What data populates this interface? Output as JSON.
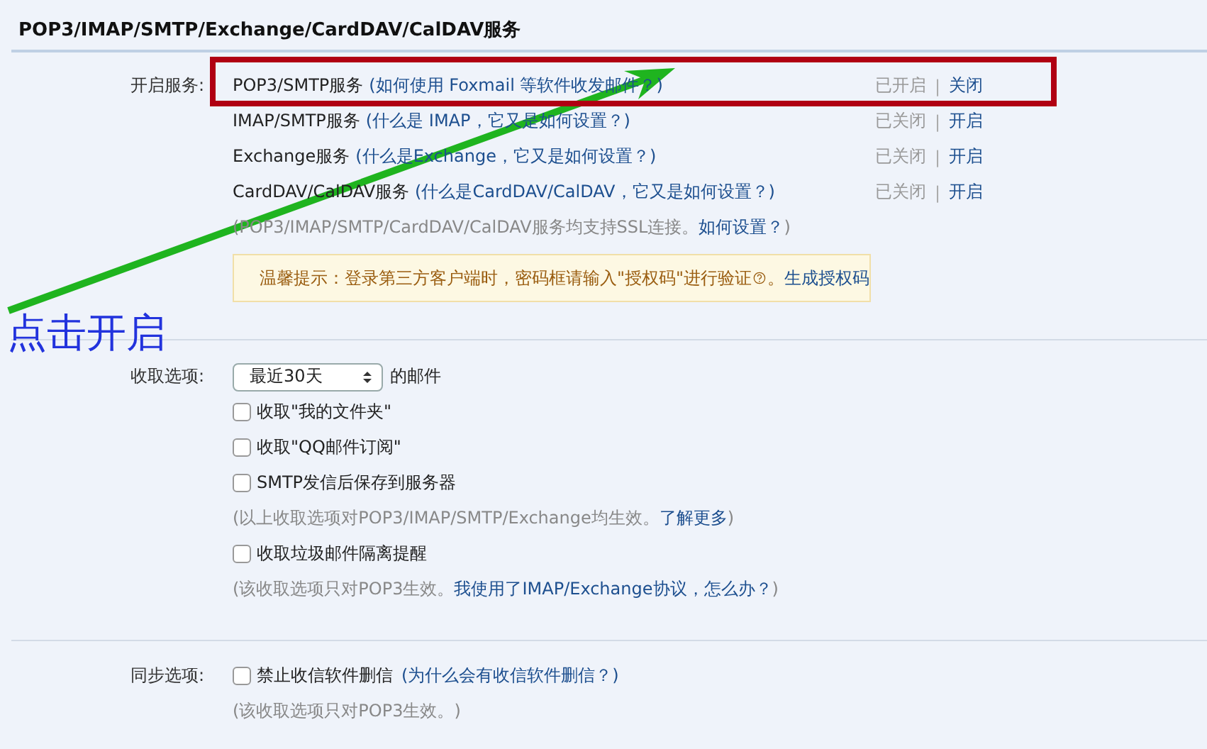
{
  "title": "POP3/IMAP/SMTP/Exchange/CardDAV/CalDAV服务",
  "services": {
    "label": "开启服务:",
    "rows": [
      {
        "name": "POP3/SMTP服务",
        "link": "(如何使用 Foxmail 等软件收发邮件？)",
        "status": "已开启",
        "separator": "|",
        "action": "关闭",
        "highlighted": true
      },
      {
        "name": "IMAP/SMTP服务",
        "link": "(什么是 IMAP，它又是如何设置？)",
        "status": "已关闭",
        "separator": "|",
        "action": "开启",
        "highlighted": false
      },
      {
        "name": "Exchange服务",
        "link": "(什么是Exchange，它又是如何设置？)",
        "status": "已关闭",
        "separator": "|",
        "action": "开启",
        "highlighted": false
      },
      {
        "name": "CardDAV/CalDAV服务",
        "link": "(什么是CardDAV/CalDAV，它又是如何设置？)",
        "status": "已关闭",
        "separator": "|",
        "action": "开启",
        "highlighted": false
      }
    ],
    "note": {
      "text": "(POP3/IMAP/SMTP/CardDAV/CalDAV服务均支持SSL连接。",
      "link": "如何设置？",
      "tail": ")"
    },
    "tip": {
      "text": "温馨提示：登录第三方客户端时，密码框请输入\"授权码\"进行验证",
      "after": "。",
      "link": "生成授权码"
    }
  },
  "receive": {
    "label": "收取选项:",
    "select": "最近30天",
    "select_suffix": "的邮件",
    "items": [
      {
        "kind": "checkbox",
        "label": "收取\"我的文件夹\"",
        "checked": false
      },
      {
        "kind": "checkbox",
        "label": "收取\"QQ邮件订阅\"",
        "checked": false
      },
      {
        "kind": "checkbox",
        "label": "SMTP发信后保存到服务器",
        "checked": false
      },
      {
        "kind": "note",
        "text": "(以上收取选项对POP3/IMAP/SMTP/Exchange均生效。",
        "link": "了解更多",
        "tail": ")"
      },
      {
        "kind": "checkbox",
        "label": "收取垃圾邮件隔离提醒",
        "checked": false
      },
      {
        "kind": "note",
        "text": "(该收取选项只对POP3生效。",
        "link": "我使用了IMAP/Exchange协议，怎么办？",
        "tail": ")"
      }
    ]
  },
  "sync": {
    "label": "同步选项:",
    "items": [
      {
        "kind": "checkbox",
        "label": "禁止收信软件删信",
        "checked": false,
        "link": "(为什么会有收信软件删信？)"
      },
      {
        "kind": "note",
        "text": "(该收取选项只对POP3生效。)"
      }
    ]
  },
  "annotation": {
    "text": "点击开启"
  }
}
